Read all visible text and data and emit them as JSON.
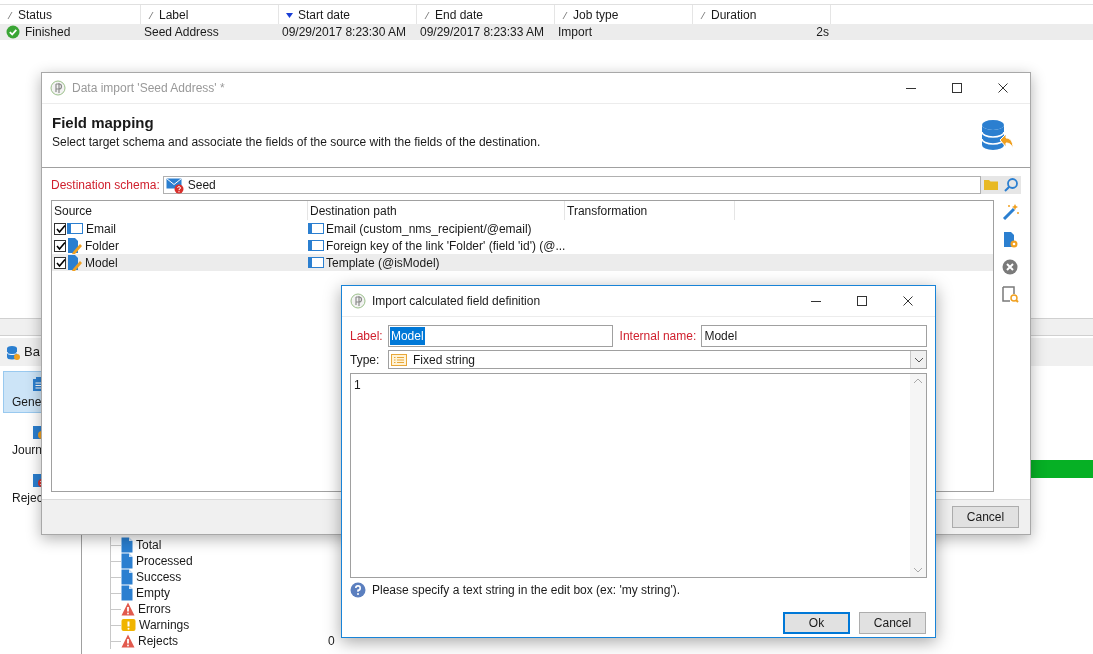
{
  "jobs_table": {
    "columns": [
      {
        "label": "Status",
        "sorted": false
      },
      {
        "label": "Label",
        "sorted": false
      },
      {
        "label": "Start date",
        "sorted": true
      },
      {
        "label": "End date",
        "sorted": false
      },
      {
        "label": "Job type",
        "sorted": false
      },
      {
        "label": "Duration",
        "sorted": false
      }
    ],
    "rows": [
      {
        "status": "Finished",
        "label": "Seed Address",
        "start_date": "09/29/2017 8:23:30 AM",
        "end_date": "09/29/2017 8:23:33 AM",
        "job_type": "Import",
        "duration": "2s",
        "selected": true
      }
    ]
  },
  "section_bar": {
    "label": "Ba"
  },
  "progress": {
    "level": 1
  },
  "side_nav": {
    "items": [
      {
        "label": "Gene",
        "kind": "general",
        "selected": true
      },
      {
        "label": "Journ",
        "kind": "journal",
        "selected": false
      },
      {
        "label": "Rejec",
        "kind": "rejects",
        "selected": false
      }
    ]
  },
  "counters": {
    "items": [
      {
        "label": "Total",
        "kind": "document"
      },
      {
        "label": "Processed",
        "kind": "document"
      },
      {
        "label": "Success",
        "kind": "document"
      },
      {
        "label": "Empty",
        "kind": "document"
      },
      {
        "label": "Errors",
        "kind": "error"
      },
      {
        "label": "Warnings",
        "kind": "warning"
      },
      {
        "label": "Rejects",
        "kind": "error",
        "value": "0"
      }
    ]
  },
  "import_dialog": {
    "title": "Data import 'Seed Address' *",
    "heading": "Field mapping",
    "description": "Select target schema and associate the fields of the source with the fields of the destination.",
    "schema_label": "Destination schema:",
    "schema_value": "Seed",
    "columns": [
      "Source",
      "Destination path",
      "Transformation"
    ],
    "rows": [
      {
        "source": "Email",
        "kind": "field",
        "checked": true,
        "destination": "Email (custom_nms_recipient/@email)",
        "selected": false
      },
      {
        "source": "Folder",
        "kind": "computed",
        "checked": true,
        "destination": "Foreign key of the link 'Folder' (field 'id') (@...",
        "selected": false
      },
      {
        "source": "Model",
        "kind": "computed",
        "checked": true,
        "destination": "Template (@isModel)",
        "selected": true
      }
    ],
    "buttons": [
      "Cancel"
    ]
  },
  "calc_dialog": {
    "title": "Import calculated field definition",
    "label_label": "Label:",
    "label_value": "Model",
    "internal_label": "Internal name:",
    "internal_value": "Model",
    "type_label": "Type:",
    "type_value": "Fixed string",
    "expression": "1",
    "hint": "Please specify a text string in the edit box (ex: 'my string').",
    "buttons": [
      {
        "label": "Ok",
        "default": true
      },
      {
        "label": "Cancel",
        "default": false
      }
    ]
  }
}
